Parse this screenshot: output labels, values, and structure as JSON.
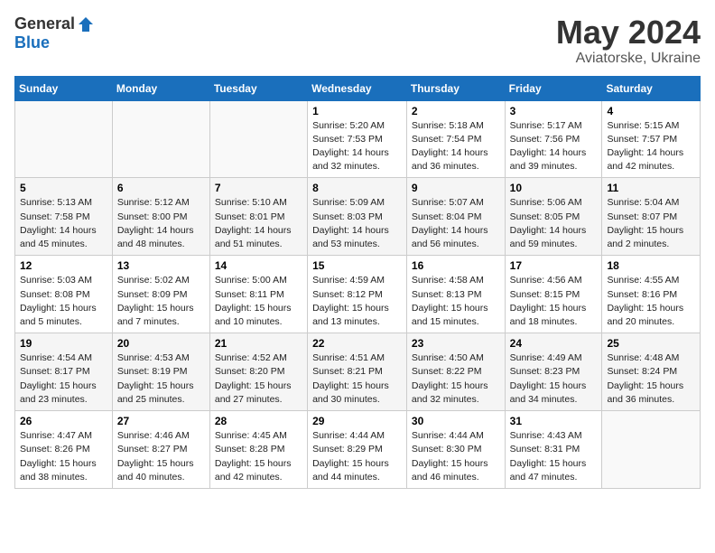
{
  "header": {
    "logo_general": "General",
    "logo_blue": "Blue",
    "month_title": "May 2024",
    "location": "Aviatorske, Ukraine"
  },
  "weekdays": [
    "Sunday",
    "Monday",
    "Tuesday",
    "Wednesday",
    "Thursday",
    "Friday",
    "Saturday"
  ],
  "weeks": [
    [
      {
        "day": "",
        "sunrise": "",
        "sunset": "",
        "daylight": ""
      },
      {
        "day": "",
        "sunrise": "",
        "sunset": "",
        "daylight": ""
      },
      {
        "day": "",
        "sunrise": "",
        "sunset": "",
        "daylight": ""
      },
      {
        "day": "1",
        "sunrise": "Sunrise: 5:20 AM",
        "sunset": "Sunset: 7:53 PM",
        "daylight": "Daylight: 14 hours and 32 minutes."
      },
      {
        "day": "2",
        "sunrise": "Sunrise: 5:18 AM",
        "sunset": "Sunset: 7:54 PM",
        "daylight": "Daylight: 14 hours and 36 minutes."
      },
      {
        "day": "3",
        "sunrise": "Sunrise: 5:17 AM",
        "sunset": "Sunset: 7:56 PM",
        "daylight": "Daylight: 14 hours and 39 minutes."
      },
      {
        "day": "4",
        "sunrise": "Sunrise: 5:15 AM",
        "sunset": "Sunset: 7:57 PM",
        "daylight": "Daylight: 14 hours and 42 minutes."
      }
    ],
    [
      {
        "day": "5",
        "sunrise": "Sunrise: 5:13 AM",
        "sunset": "Sunset: 7:58 PM",
        "daylight": "Daylight: 14 hours and 45 minutes."
      },
      {
        "day": "6",
        "sunrise": "Sunrise: 5:12 AM",
        "sunset": "Sunset: 8:00 PM",
        "daylight": "Daylight: 14 hours and 48 minutes."
      },
      {
        "day": "7",
        "sunrise": "Sunrise: 5:10 AM",
        "sunset": "Sunset: 8:01 PM",
        "daylight": "Daylight: 14 hours and 51 minutes."
      },
      {
        "day": "8",
        "sunrise": "Sunrise: 5:09 AM",
        "sunset": "Sunset: 8:03 PM",
        "daylight": "Daylight: 14 hours and 53 minutes."
      },
      {
        "day": "9",
        "sunrise": "Sunrise: 5:07 AM",
        "sunset": "Sunset: 8:04 PM",
        "daylight": "Daylight: 14 hours and 56 minutes."
      },
      {
        "day": "10",
        "sunrise": "Sunrise: 5:06 AM",
        "sunset": "Sunset: 8:05 PM",
        "daylight": "Daylight: 14 hours and 59 minutes."
      },
      {
        "day": "11",
        "sunrise": "Sunrise: 5:04 AM",
        "sunset": "Sunset: 8:07 PM",
        "daylight": "Daylight: 15 hours and 2 minutes."
      }
    ],
    [
      {
        "day": "12",
        "sunrise": "Sunrise: 5:03 AM",
        "sunset": "Sunset: 8:08 PM",
        "daylight": "Daylight: 15 hours and 5 minutes."
      },
      {
        "day": "13",
        "sunrise": "Sunrise: 5:02 AM",
        "sunset": "Sunset: 8:09 PM",
        "daylight": "Daylight: 15 hours and 7 minutes."
      },
      {
        "day": "14",
        "sunrise": "Sunrise: 5:00 AM",
        "sunset": "Sunset: 8:11 PM",
        "daylight": "Daylight: 15 hours and 10 minutes."
      },
      {
        "day": "15",
        "sunrise": "Sunrise: 4:59 AM",
        "sunset": "Sunset: 8:12 PM",
        "daylight": "Daylight: 15 hours and 13 minutes."
      },
      {
        "day": "16",
        "sunrise": "Sunrise: 4:58 AM",
        "sunset": "Sunset: 8:13 PM",
        "daylight": "Daylight: 15 hours and 15 minutes."
      },
      {
        "day": "17",
        "sunrise": "Sunrise: 4:56 AM",
        "sunset": "Sunset: 8:15 PM",
        "daylight": "Daylight: 15 hours and 18 minutes."
      },
      {
        "day": "18",
        "sunrise": "Sunrise: 4:55 AM",
        "sunset": "Sunset: 8:16 PM",
        "daylight": "Daylight: 15 hours and 20 minutes."
      }
    ],
    [
      {
        "day": "19",
        "sunrise": "Sunrise: 4:54 AM",
        "sunset": "Sunset: 8:17 PM",
        "daylight": "Daylight: 15 hours and 23 minutes."
      },
      {
        "day": "20",
        "sunrise": "Sunrise: 4:53 AM",
        "sunset": "Sunset: 8:19 PM",
        "daylight": "Daylight: 15 hours and 25 minutes."
      },
      {
        "day": "21",
        "sunrise": "Sunrise: 4:52 AM",
        "sunset": "Sunset: 8:20 PM",
        "daylight": "Daylight: 15 hours and 27 minutes."
      },
      {
        "day": "22",
        "sunrise": "Sunrise: 4:51 AM",
        "sunset": "Sunset: 8:21 PM",
        "daylight": "Daylight: 15 hours and 30 minutes."
      },
      {
        "day": "23",
        "sunrise": "Sunrise: 4:50 AM",
        "sunset": "Sunset: 8:22 PM",
        "daylight": "Daylight: 15 hours and 32 minutes."
      },
      {
        "day": "24",
        "sunrise": "Sunrise: 4:49 AM",
        "sunset": "Sunset: 8:23 PM",
        "daylight": "Daylight: 15 hours and 34 minutes."
      },
      {
        "day": "25",
        "sunrise": "Sunrise: 4:48 AM",
        "sunset": "Sunset: 8:24 PM",
        "daylight": "Daylight: 15 hours and 36 minutes."
      }
    ],
    [
      {
        "day": "26",
        "sunrise": "Sunrise: 4:47 AM",
        "sunset": "Sunset: 8:26 PM",
        "daylight": "Daylight: 15 hours and 38 minutes."
      },
      {
        "day": "27",
        "sunrise": "Sunrise: 4:46 AM",
        "sunset": "Sunset: 8:27 PM",
        "daylight": "Daylight: 15 hours and 40 minutes."
      },
      {
        "day": "28",
        "sunrise": "Sunrise: 4:45 AM",
        "sunset": "Sunset: 8:28 PM",
        "daylight": "Daylight: 15 hours and 42 minutes."
      },
      {
        "day": "29",
        "sunrise": "Sunrise: 4:44 AM",
        "sunset": "Sunset: 8:29 PM",
        "daylight": "Daylight: 15 hours and 44 minutes."
      },
      {
        "day": "30",
        "sunrise": "Sunrise: 4:44 AM",
        "sunset": "Sunset: 8:30 PM",
        "daylight": "Daylight: 15 hours and 46 minutes."
      },
      {
        "day": "31",
        "sunrise": "Sunrise: 4:43 AM",
        "sunset": "Sunset: 8:31 PM",
        "daylight": "Daylight: 15 hours and 47 minutes."
      },
      {
        "day": "",
        "sunrise": "",
        "sunset": "",
        "daylight": ""
      }
    ]
  ]
}
